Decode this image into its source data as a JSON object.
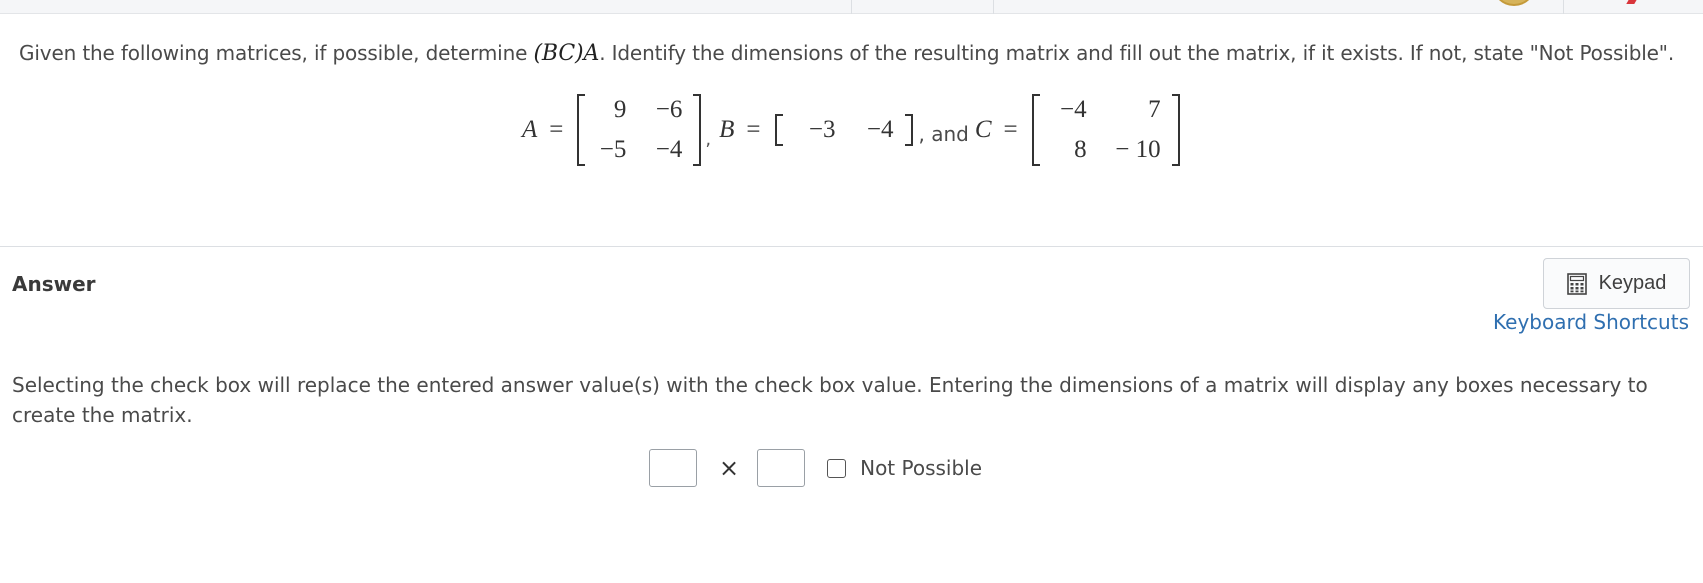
{
  "question": {
    "text_before": "Given the following matrices, if possible, determine ",
    "expression": "(BC)A",
    "text_after": ". Identify the dimensions of the resulting matrix and fill out the matrix, if it exists. If not, state \"Not Possible\"."
  },
  "matrices": {
    "A": {
      "name": "A",
      "rows": [
        [
          "9",
          "−6"
        ],
        [
          "−5",
          "−4"
        ]
      ]
    },
    "B": {
      "name": "B",
      "rows": [
        [
          "−3",
          "−4"
        ]
      ]
    },
    "C": {
      "name": "C",
      "rows": [
        [
          "−4",
          "7"
        ],
        [
          "8",
          "− 10"
        ]
      ]
    },
    "equals": "=",
    "comma": ",",
    "and_text": ", and"
  },
  "answer": {
    "label": "Answer",
    "keypad_label": "Keypad",
    "keypad_icon": "calculator-icon",
    "shortcuts_label": "Keyboard Shortcuts",
    "instructions": "Selecting the check box will replace the entered answer value(s) with the check box value. Entering the dimensions of a matrix will display any boxes necessary to create the matrix.",
    "times_symbol": "×",
    "not_possible_label": "Not Possible",
    "rows_value": "",
    "cols_value": ""
  },
  "colors": {
    "link": "#2f6fb0",
    "text": "#4a4a4a"
  }
}
